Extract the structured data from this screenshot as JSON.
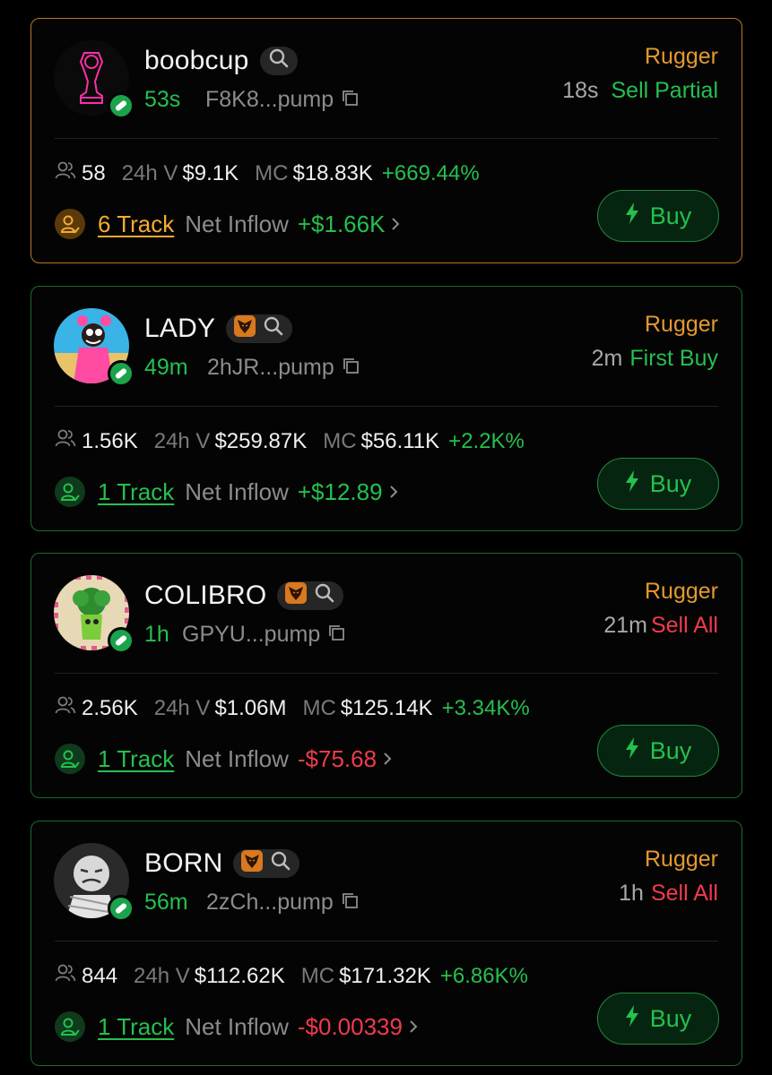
{
  "cards": [
    {
      "name": "boobcup",
      "age": "53s",
      "address": "F8K8...pump",
      "status": "Rugger",
      "action_time": "18s",
      "action_label": "Sell Partial",
      "holders": "58",
      "vol_label": "24h V",
      "volume": "$9.1K",
      "mc_label": "MC",
      "mc": "$18.83K",
      "change": "+669.44%",
      "track_label": "6 Track",
      "inflow_label": "Net Inflow",
      "inflow": "+$1.66K",
      "buy_label": "Buy"
    },
    {
      "name": "LADY",
      "age": "49m",
      "address": "2hJR...pump",
      "status": "Rugger",
      "action_time": "2m",
      "action_label": "First Buy",
      "holders": "1.56K",
      "vol_label": "24h V",
      "volume": "$259.87K",
      "mc_label": "MC",
      "mc": "$56.11K",
      "change": "+2.2K%",
      "track_label": "1 Track",
      "inflow_label": "Net Inflow",
      "inflow": "+$12.89",
      "buy_label": "Buy"
    },
    {
      "name": "COLIBRO",
      "age": "1h",
      "address": "GPYU...pump",
      "status": "Rugger",
      "action_time": "21m",
      "action_label": "Sell All",
      "holders": "2.56K",
      "vol_label": "24h V",
      "volume": "$1.06M",
      "mc_label": "MC",
      "mc": "$125.14K",
      "change": "+3.34K%",
      "track_label": "1 Track",
      "inflow_label": "Net Inflow",
      "inflow": "-$75.68",
      "buy_label": "Buy"
    },
    {
      "name": "BORN",
      "age": "56m",
      "address": "2zCh...pump",
      "status": "Rugger",
      "action_time": "1h",
      "action_label": "Sell All",
      "holders": "844",
      "vol_label": "24h V",
      "volume": "$112.62K",
      "mc_label": "MC",
      "mc": "$171.32K",
      "change": "+6.86K%",
      "track_label": "1 Track",
      "inflow_label": "Net Inflow",
      "inflow": "-$0.00339",
      "buy_label": "Buy"
    }
  ],
  "colors": {
    "green": "#25c04e",
    "red": "#ef3b4d",
    "orange": "#e39a2e",
    "border_green": "#1c6b2c",
    "border_orange": "#b9781f"
  },
  "icons": [
    "holders-icon",
    "track-user-icon",
    "search-icon",
    "copy-icon",
    "lightning-icon",
    "eagle-badge-icon",
    "pill-icon",
    "chevron-right-icon"
  ]
}
